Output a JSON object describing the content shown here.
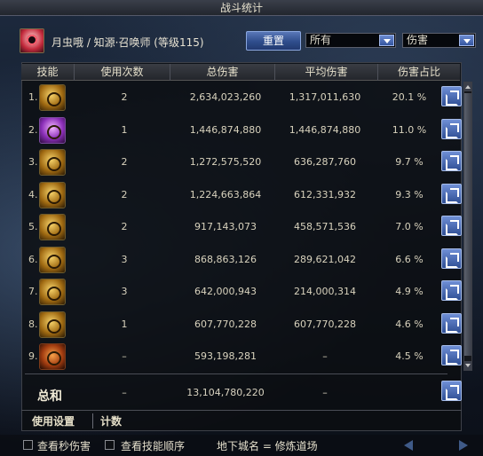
{
  "window": {
    "title": "战斗统计"
  },
  "header": {
    "character": "月虫哦 / 知源·召唤师 (等级115)",
    "reset_label": "重置",
    "filter_value": "所有",
    "metric_value": "伤害"
  },
  "table": {
    "columns": [
      "技能",
      "使用次数",
      "总伤害",
      "平均伤害",
      "伤害占比"
    ],
    "rows": [
      {
        "idx": "1.",
        "icon": "skill-icon-1",
        "uses": "2",
        "total": "2,634,023,260",
        "avg": "1,317,011,630",
        "pct": "20.1 %"
      },
      {
        "idx": "2.",
        "icon": "skill-icon-2",
        "uses": "1",
        "total": "1,446,874,880",
        "avg": "1,446,874,880",
        "pct": "11.0 %"
      },
      {
        "idx": "3.",
        "icon": "skill-icon-3",
        "uses": "2",
        "total": "1,272,575,520",
        "avg": "636,287,760",
        "pct": "9.7 %"
      },
      {
        "idx": "4.",
        "icon": "skill-icon-4",
        "uses": "2",
        "total": "1,224,663,864",
        "avg": "612,331,932",
        "pct": "9.3 %"
      },
      {
        "idx": "5.",
        "icon": "skill-icon-5",
        "uses": "2",
        "total": "917,143,073",
        "avg": "458,571,536",
        "pct": "7.0 %"
      },
      {
        "idx": "6.",
        "icon": "skill-icon-6",
        "uses": "3",
        "total": "868,863,126",
        "avg": "289,621,042",
        "pct": "6.6 %"
      },
      {
        "idx": "7.",
        "icon": "skill-icon-7",
        "uses": "3",
        "total": "642,000,943",
        "avg": "214,000,314",
        "pct": "4.9 %"
      },
      {
        "idx": "8.",
        "icon": "skill-icon-8",
        "uses": "1",
        "total": "607,770,228",
        "avg": "607,770,228",
        "pct": "4.6 %"
      },
      {
        "idx": "9.",
        "icon": "skill-icon-9",
        "uses": "–",
        "total": "593,198,281",
        "avg": "–",
        "pct": "4.5 %"
      }
    ]
  },
  "total": {
    "label": "总和",
    "uses": "–",
    "total": "13,104,780,220",
    "avg": "–"
  },
  "tabs": {
    "settings": "使用设置",
    "count": "计数"
  },
  "footer": {
    "per_second_label": "查看秒伤害",
    "skill_order_label": "查看技能顺序",
    "dungeon": "地下城名 = 修炼道场"
  }
}
